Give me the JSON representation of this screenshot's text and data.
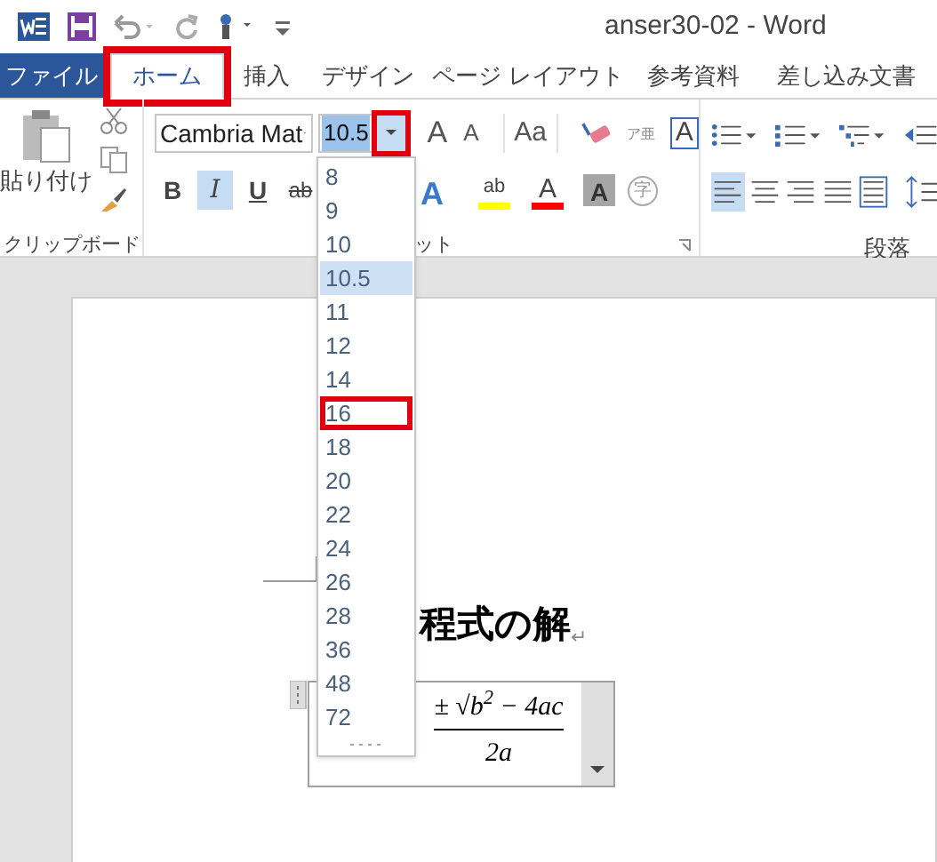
{
  "title_bar": {
    "title": "anser30-02 - Word"
  },
  "tabs": [
    {
      "label": "ファイル",
      "kind": "file",
      "selected": false,
      "highlighted": false
    },
    {
      "label": "ホーム",
      "kind": "tab",
      "selected": true,
      "highlighted": true
    },
    {
      "label": "挿入",
      "kind": "tab",
      "selected": false,
      "highlighted": false
    },
    {
      "label": "デザイン",
      "kind": "tab",
      "selected": false,
      "highlighted": false
    },
    {
      "label": "ページ レイアウト",
      "kind": "tab",
      "selected": false,
      "highlighted": false
    },
    {
      "label": "参考資料",
      "kind": "tab",
      "selected": false,
      "highlighted": false
    },
    {
      "label": "差し込み文書",
      "kind": "tab",
      "selected": false,
      "highlighted": false
    }
  ],
  "clipboard": {
    "paste_label": "貼り付け",
    "group_label": "クリップボード"
  },
  "font": {
    "font_name": "Cambria Mat",
    "font_size": "10.5",
    "size_arrow_highlighted": true,
    "group_label": "ット",
    "row1": [
      {
        "kind": "grow",
        "label": "A"
      },
      {
        "kind": "shrink",
        "label": "A"
      },
      {
        "kind": "case",
        "label": "Aa"
      },
      {
        "kind": "clear"
      },
      {
        "kind": "phonetic",
        "label": "ア亜"
      },
      {
        "kind": "border",
        "label": "A"
      }
    ],
    "row2": [
      {
        "kind": "bold",
        "label": "B",
        "selected": false
      },
      {
        "kind": "italic",
        "label": "I",
        "selected": true
      },
      {
        "kind": "underline",
        "label": "U",
        "selected": false
      },
      {
        "kind": "strike",
        "label": "ab",
        "selected": false
      },
      {
        "kind": "effect",
        "label": "A",
        "selected": false
      },
      {
        "kind": "highlight",
        "label": "ab",
        "selected": false
      },
      {
        "kind": "color",
        "label": "A",
        "selected": false
      },
      {
        "kind": "shading",
        "label": "A",
        "selected": false
      },
      {
        "kind": "enclose",
        "label": "字",
        "selected": false
      }
    ]
  },
  "paragraph": {
    "group_label": "段落",
    "row1": [
      {
        "kind": "bullets"
      },
      {
        "kind": "numbering"
      },
      {
        "kind": "multilevel"
      },
      {
        "kind": "outdent"
      }
    ],
    "row2": [
      {
        "kind": "left",
        "selected": true
      },
      {
        "kind": "center",
        "selected": false
      },
      {
        "kind": "right",
        "selected": false
      },
      {
        "kind": "justify",
        "selected": false
      },
      {
        "kind": "distributed",
        "selected": false
      },
      {
        "kind": "spacing",
        "selected": false
      }
    ]
  },
  "size_dropdown": {
    "items": [
      {
        "label": "8",
        "selected": false,
        "highlighted": false
      },
      {
        "label": "9",
        "selected": false,
        "highlighted": false
      },
      {
        "label": "10",
        "selected": false,
        "highlighted": false
      },
      {
        "label": "10.5",
        "selected": true,
        "highlighted": false
      },
      {
        "label": "11",
        "selected": false,
        "highlighted": false
      },
      {
        "label": "12",
        "selected": false,
        "highlighted": false
      },
      {
        "label": "14",
        "selected": false,
        "highlighted": false
      },
      {
        "label": "16",
        "selected": false,
        "highlighted": true
      },
      {
        "label": "18",
        "selected": false,
        "highlighted": false
      },
      {
        "label": "20",
        "selected": false,
        "highlighted": false
      },
      {
        "label": "22",
        "selected": false,
        "highlighted": false
      },
      {
        "label": "24",
        "selected": false,
        "highlighted": false
      },
      {
        "label": "26",
        "selected": false,
        "highlighted": false
      },
      {
        "label": "28",
        "selected": false,
        "highlighted": false
      },
      {
        "label": "36",
        "selected": false,
        "highlighted": false
      },
      {
        "label": "48",
        "selected": false,
        "highlighted": false
      },
      {
        "label": "72",
        "selected": false,
        "highlighted": false
      }
    ]
  },
  "document": {
    "heading": "程式の解",
    "paragraph_mark": "↵",
    "equation": {
      "numerator": "± √b$^{2}$ − 4ac",
      "denominator": "2a"
    }
  }
}
